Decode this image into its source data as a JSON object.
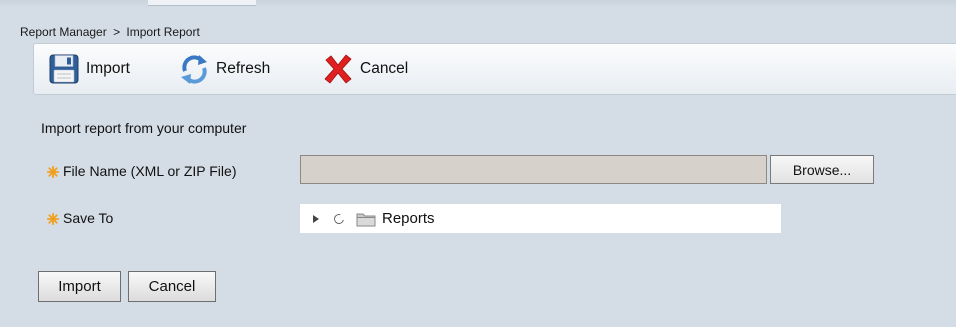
{
  "breadcrumb": {
    "parent": "Report Manager",
    "separator": ">",
    "current": "Import Report"
  },
  "toolbar": {
    "items": [
      {
        "label": "Import",
        "icon": "floppy-disk-icon"
      },
      {
        "label": "Refresh",
        "icon": "refresh-arrows-icon"
      },
      {
        "label": "Cancel",
        "icon": "red-x-icon"
      }
    ]
  },
  "form": {
    "section_title": "Import report from your computer",
    "file_name": {
      "label": "File Name (XML or ZIP File)",
      "value": "",
      "browse_label": "Browse...",
      "required_icon": "required-star-icon"
    },
    "save_to": {
      "label": "Save To",
      "required_icon": "required-star-icon",
      "tree": {
        "root_label": "Reports",
        "expanded": false,
        "selected": false
      }
    }
  },
  "actions": {
    "import_label": "Import",
    "cancel_label": "Cancel"
  },
  "colors": {
    "background": "#d4dde6",
    "required_star": "#f0a020",
    "cancel_x": "#e02020",
    "refresh_blue": "#3a78c4"
  }
}
